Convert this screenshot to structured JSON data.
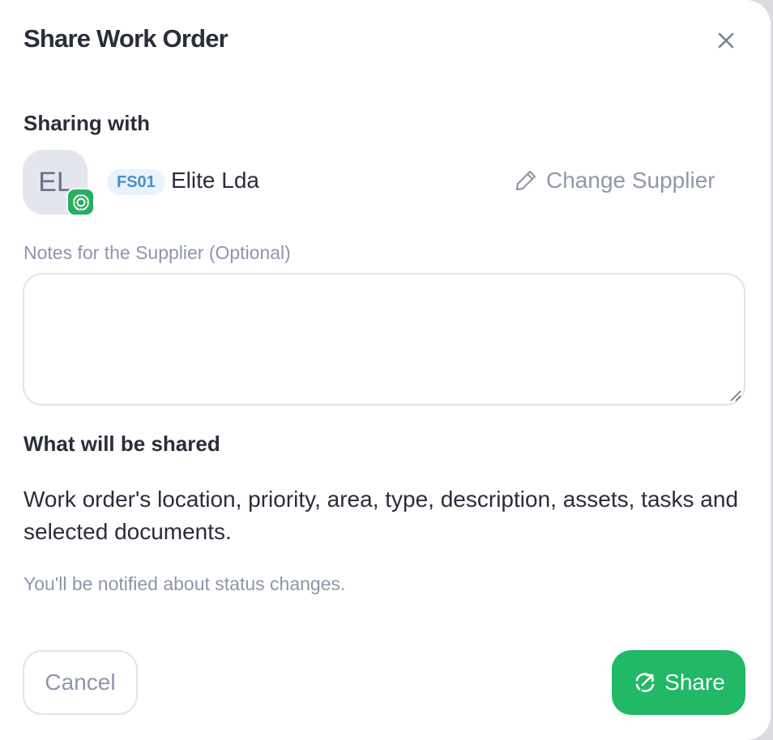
{
  "dialog": {
    "title": "Share Work Order",
    "close_icon": "close-icon"
  },
  "sharing": {
    "heading": "Sharing with",
    "avatar_initials": "EL",
    "avatar_badge_icon": "target-icon",
    "supplier_code": "FS01",
    "supplier_name": "Elite Lda",
    "change_icon": "pencil-icon",
    "change_label": "Change Supplier"
  },
  "notes": {
    "label": "Notes for the Supplier (Optional)",
    "value": "",
    "placeholder": ""
  },
  "shared_info": {
    "heading": "What will be shared",
    "description": "Work order's location, priority, area, type, description, assets, tasks and selected documents.",
    "notify_text": "You'll be notified about status changes."
  },
  "actions": {
    "cancel_label": "Cancel",
    "share_label": "Share",
    "share_icon": "share-target-icon"
  },
  "colors": {
    "primary": "#21b866",
    "badge_green": "#27ae60",
    "code_pill_text": "#4a8fd0",
    "code_pill_bg": "#eaf2fb",
    "muted_text": "#8e95ab",
    "dark_text": "#2a2d3a"
  }
}
